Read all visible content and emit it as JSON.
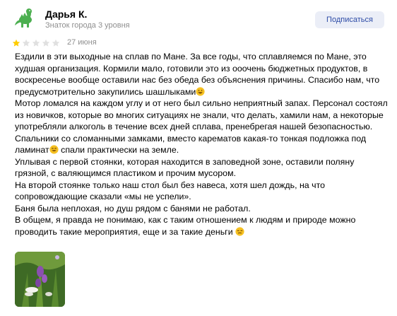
{
  "author": {
    "name": "Дарья К.",
    "level": "Знаток города 3 уровня",
    "avatar_icon": "dinosaur-icon"
  },
  "subscribe_label": "Подписаться",
  "rating": {
    "value": 1,
    "max": 5
  },
  "date": "27 июня",
  "review": {
    "paragraphs": [
      "Ездили в эти выходные на сплав по Мане. За все годы, что сплавляемся по Мане, это худшая организация. Кормили мало, готовили это из ооочень бюджетных продуктов, в воскресенье вообще оставили нас без обеда без объяснения причины. Спасибо нам, что предусмотрительно закупились шашлыками",
      "Мотор ломался на каждом углу и от него был сильно неприятный запах. Персонал состоял из новичков, которые во многих ситуациях не знали, что делать, хамили нам, а некоторые употребляли алкоголь в течение всех дней сплава, пренебрегая нашей безопасностью.",
      "Спальники со сломанными замками, вместо карематов какая-то тонкая подложка под ламинат",
      " спали практически на земле.",
      "Уплывая с первой стоянки, которая находится в заповедной зоне, оставили поляну грязной, с валяющимся пластиком и прочим мусором.",
      "На второй стоянке только наш стол был без навеса, хотя шел дождь, на что сопровождающие сказали «мы не успели».",
      "Баня была неплохая, но душ рядом с банями не работал.",
      "В общем, я правда не понимаю, как с таким отношением к людям и природе можно проводить такие мероприятия, еще и за такие деньги "
    ]
  },
  "photo": {
    "icon": "photo-thumbnail-flowers"
  },
  "colors": {
    "star_filled": "#fc0",
    "star_empty": "#e0e0e0",
    "subscribe_bg": "#ebeef7",
    "subscribe_text": "#2d4ba6",
    "muted_text": "#8f8f8f",
    "avatar_green": "#4caf50",
    "emoji_yellow": "#f5c021"
  }
}
